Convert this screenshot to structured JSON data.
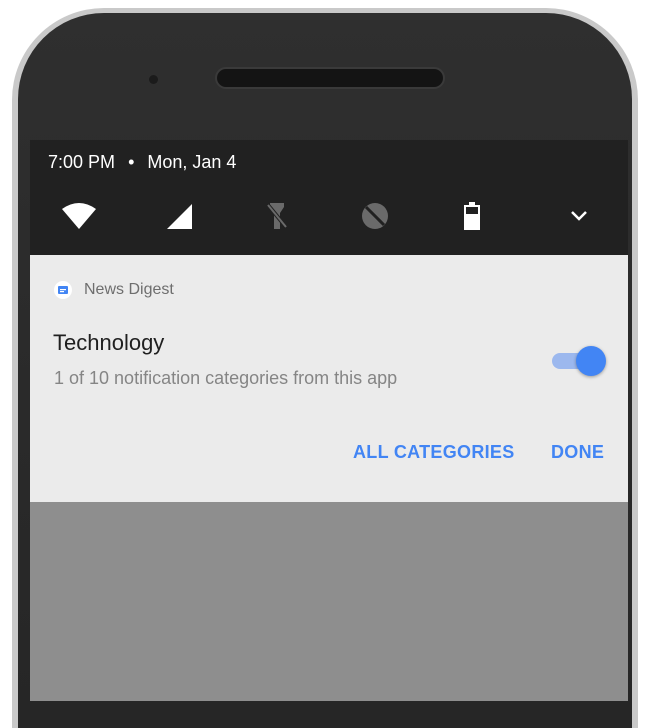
{
  "status": {
    "time": "7:00 PM",
    "separator": "•",
    "date": "Mon, Jan 4"
  },
  "quick_settings": {
    "icons": [
      "wifi-icon",
      "cell-signal-icon",
      "flashlight-off-icon",
      "rotation-lock-icon",
      "battery-icon",
      "chevron-down-icon"
    ]
  },
  "notification": {
    "app_name": "News Digest",
    "title": "Technology",
    "subtitle": "1 of 10 notification categories from this app",
    "toggle_on": true,
    "actions": {
      "all_categories": "ALL CATEGORIES",
      "done": "DONE"
    }
  },
  "colors": {
    "accent": "#4285f4",
    "shade_bg": "#212121",
    "card_bg": "#ebebeb",
    "scrim": "#8e8e8e"
  }
}
